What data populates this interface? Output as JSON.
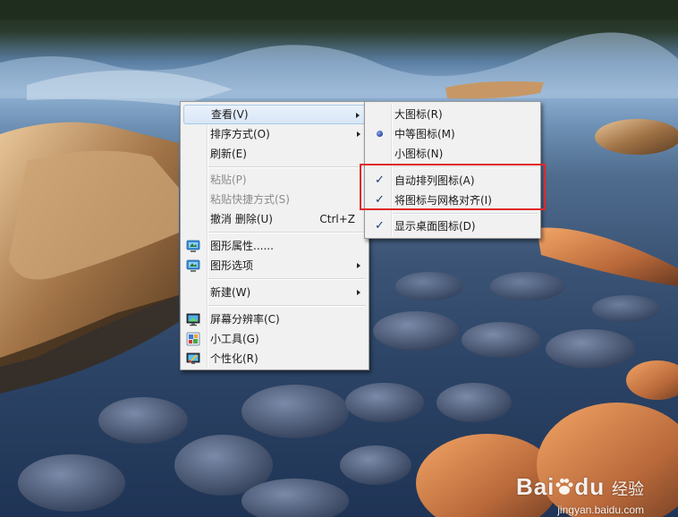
{
  "context_menu": {
    "items": [
      {
        "label": "查看(V)",
        "has_submenu": true
      },
      {
        "label": "排序方式(O)",
        "has_submenu": true
      },
      {
        "label": "刷新(E)"
      },
      {
        "label": "粘贴(P)",
        "disabled": true
      },
      {
        "label": "粘贴快捷方式(S)",
        "disabled": true
      },
      {
        "label": "撤消 删除(U)",
        "shortcut": "Ctrl+Z"
      },
      {
        "label": "图形属性......",
        "icon": "intel-graphics-icon"
      },
      {
        "label": "图形选项",
        "icon": "intel-graphics-icon",
        "has_submenu": true
      },
      {
        "label": "新建(W)",
        "has_submenu": true
      },
      {
        "label": "屏幕分辨率(C)",
        "icon": "display-icon"
      },
      {
        "label": "小工具(G)",
        "icon": "gadgets-icon"
      },
      {
        "label": "个性化(R)",
        "icon": "personalize-icon"
      }
    ]
  },
  "view_submenu": {
    "items": [
      {
        "label": "大图标(R)"
      },
      {
        "label": "中等图标(M)",
        "selected": true
      },
      {
        "label": "小图标(N)"
      },
      {
        "label": "自动排列图标(A)",
        "checked": true
      },
      {
        "label": "将图标与网格对齐(I)",
        "checked": true
      },
      {
        "label": "显示桌面图标(D)",
        "checked": true
      }
    ]
  },
  "glyphs": {
    "check": "✓"
  },
  "watermark": {
    "brand": "Bai",
    "brand2": "du",
    "sub": "经验",
    "url": "jingyan.baidu.com"
  },
  "colors": {
    "highlight_box": "#e0282a",
    "menu_bg": "#f1f1f1"
  }
}
